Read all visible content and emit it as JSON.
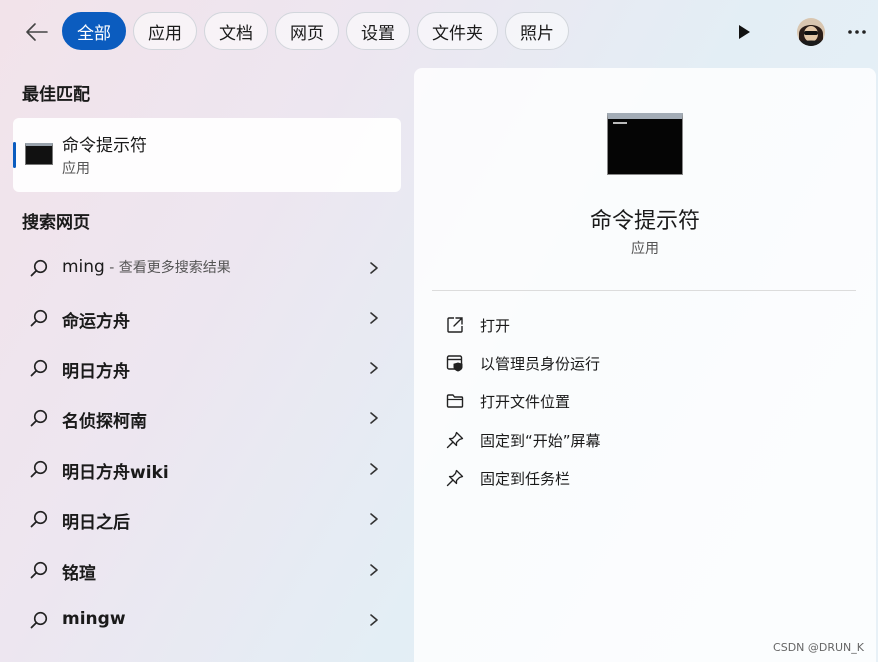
{
  "tabs": [
    {
      "label": "全部",
      "active": true
    },
    {
      "label": "应用"
    },
    {
      "label": "文档"
    },
    {
      "label": "网页"
    },
    {
      "label": "设置"
    },
    {
      "label": "文件夹"
    },
    {
      "label": "照片"
    }
  ],
  "icons": {
    "back": "arrow-left-icon",
    "play": "play-icon",
    "more": "more-horizontal-icon",
    "search": "search-icon",
    "chevron": "chevron-right-icon"
  },
  "best_match": {
    "section_title": "最佳匹配",
    "title": "命令提示符",
    "subtitle": "应用"
  },
  "web": {
    "section_title": "搜索网页",
    "results": [
      {
        "text": "ming",
        "hint": " - 查看更多搜索结果"
      },
      {
        "text": "命运方舟"
      },
      {
        "text": "明日方舟"
      },
      {
        "text": "名侦探柯南"
      },
      {
        "text": "明日方舟wiki"
      },
      {
        "text": "明日之后"
      },
      {
        "text": "铭瑄"
      },
      {
        "text": "mingw"
      }
    ]
  },
  "detail": {
    "app_name": "命令提示符",
    "app_type": "应用",
    "actions": [
      {
        "label": "打开",
        "icon": "open-external-icon"
      },
      {
        "label": "以管理员身份运行",
        "icon": "run-as-admin-icon"
      },
      {
        "label": "打开文件位置",
        "icon": "folder-icon"
      },
      {
        "label": "固定到“开始”屏幕",
        "icon": "pin-icon"
      },
      {
        "label": "固定到任务栏",
        "icon": "pin-icon"
      }
    ]
  },
  "watermark": "CSDN @DRUN_K",
  "colors": {
    "accent": "#0b5cbf"
  }
}
